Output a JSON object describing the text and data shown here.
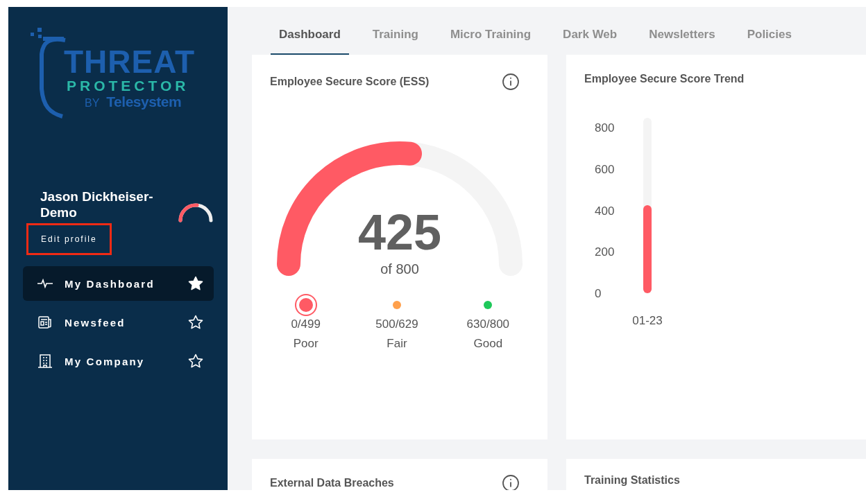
{
  "logo": {
    "title": "THREAT",
    "subtitle": "PROTECTOR",
    "by": "BY",
    "brand": "Telesystem"
  },
  "profile": {
    "name": "Jason Dickheiser-Demo",
    "edit_link": "Edit profile",
    "highlighted": true
  },
  "nav": [
    {
      "label": "My Dashboard",
      "kind": "pulse",
      "selected": true,
      "favorite": true
    },
    {
      "label": "Newsfeed",
      "kind": "news",
      "selected": false,
      "favorite": false
    },
    {
      "label": "My Company",
      "kind": "building",
      "selected": false,
      "favorite": false
    }
  ],
  "tabs": [
    {
      "label": "Dashboard",
      "selected": true
    },
    {
      "label": "Training",
      "selected": false
    },
    {
      "label": "Micro Training",
      "selected": false
    },
    {
      "label": "Dark Web",
      "selected": false
    },
    {
      "label": "Newsletters",
      "selected": false
    },
    {
      "label": "Policies",
      "selected": false
    }
  ],
  "ess_card": {
    "title": "Employee Secure Score (ESS)",
    "score": "425",
    "of": "of 800",
    "level": 0.53,
    "bands": [
      {
        "range": "0/499",
        "label": "Poor",
        "color": "#ff5a64",
        "selected": true
      },
      {
        "range": "500/629",
        "label": "Fair",
        "color": "#ffa04c",
        "selected": false
      },
      {
        "range": "630/800",
        "label": "Good",
        "color": "#1ec85a",
        "selected": false
      }
    ]
  },
  "trend_card": {
    "title": "Employee Secure Score Trend",
    "chart_data": {
      "type": "bar",
      "categories": [
        "01-23"
      ],
      "values": [
        425
      ],
      "ylim": [
        0,
        800
      ],
      "yticks": [
        0,
        200,
        400,
        600,
        800
      ]
    }
  },
  "lower_cards": [
    {
      "title": "External Data Breaches",
      "info": true
    },
    {
      "title": "Training Statistics",
      "info": false
    }
  ]
}
